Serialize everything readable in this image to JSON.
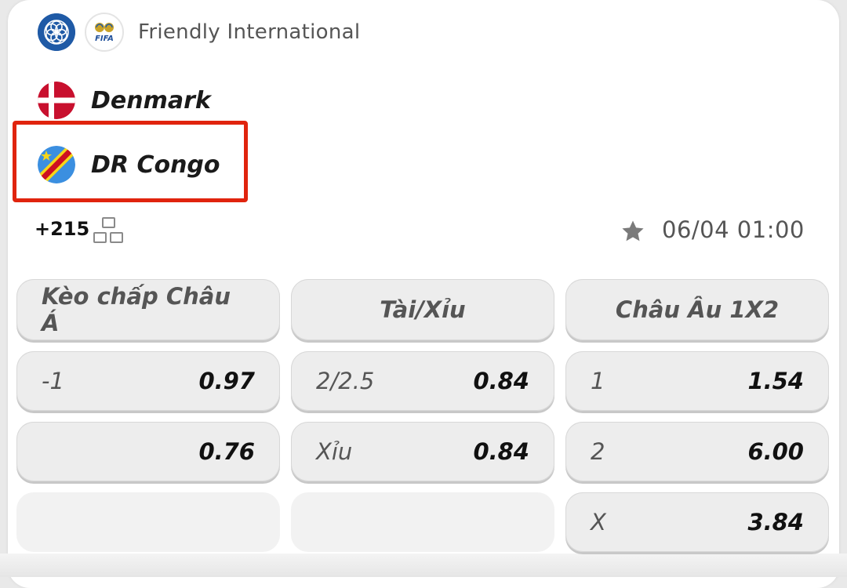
{
  "league": {
    "name": "Friendly International",
    "icons": [
      "confederation-logo-icon",
      "fifa-logo-icon"
    ],
    "fifa_logo_text": "FIFA"
  },
  "match": {
    "home_team": "Denmark",
    "away_team": "DR Congo",
    "more_markets": "+215",
    "datetime": "06/04 01:00",
    "favorite_icon": "star-icon"
  },
  "highlight_color": "#e0240e",
  "odds": {
    "headers": [
      "Kèo chấp Châu Á",
      "Tài/Xỉu",
      "Châu Âu 1X2"
    ],
    "asian_handicap": [
      {
        "label": "-1",
        "value": "0.97"
      },
      {
        "label": "",
        "value": "0.76"
      }
    ],
    "over_under": [
      {
        "label": "2/2.5",
        "value": "0.84"
      },
      {
        "label": "Xỉu",
        "value": "0.84"
      }
    ],
    "one_x_two": [
      {
        "label": "1",
        "value": "1.54"
      },
      {
        "label": "2",
        "value": "6.00"
      },
      {
        "label": "X",
        "value": "3.84"
      }
    ]
  }
}
